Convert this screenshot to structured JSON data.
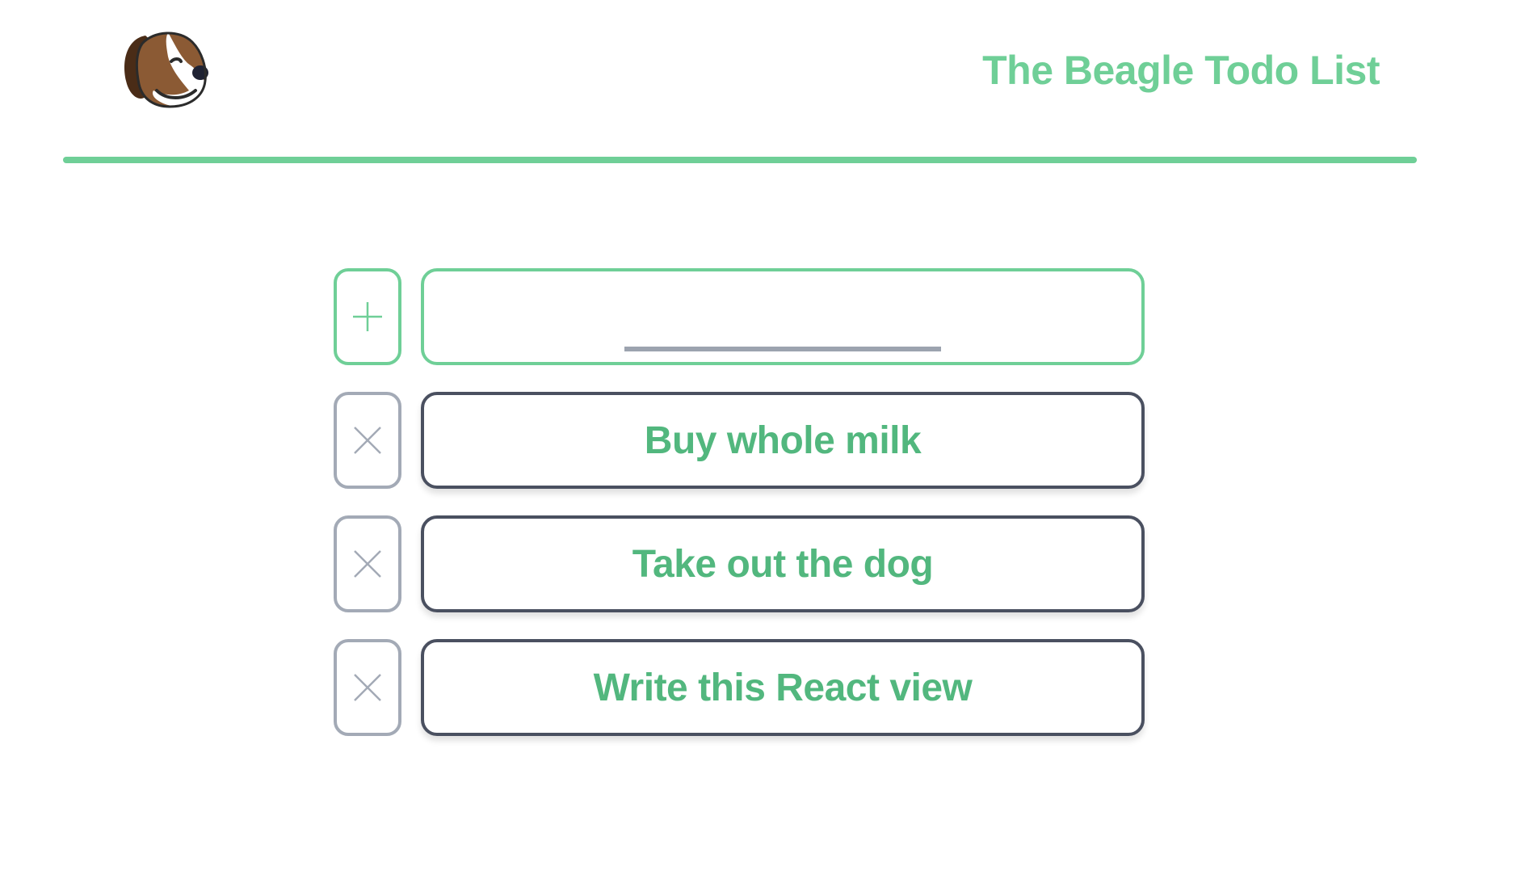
{
  "header": {
    "logo_icon": "beagle-dog-logo",
    "title": "The Beagle Todo List"
  },
  "colors": {
    "accent": "#6fcf97",
    "item_text": "#52b77e",
    "border_dark": "#4a5060",
    "border_muted": "#a3aab6",
    "input_underline": "#9ca3af"
  },
  "new_todo": {
    "add_icon": "plus-icon",
    "value": "",
    "placeholder": ""
  },
  "todos": [
    {
      "label": "Buy whole milk",
      "delete_icon": "close-icon"
    },
    {
      "label": "Take out the dog",
      "delete_icon": "close-icon"
    },
    {
      "label": "Write this React view",
      "delete_icon": "close-icon"
    }
  ]
}
